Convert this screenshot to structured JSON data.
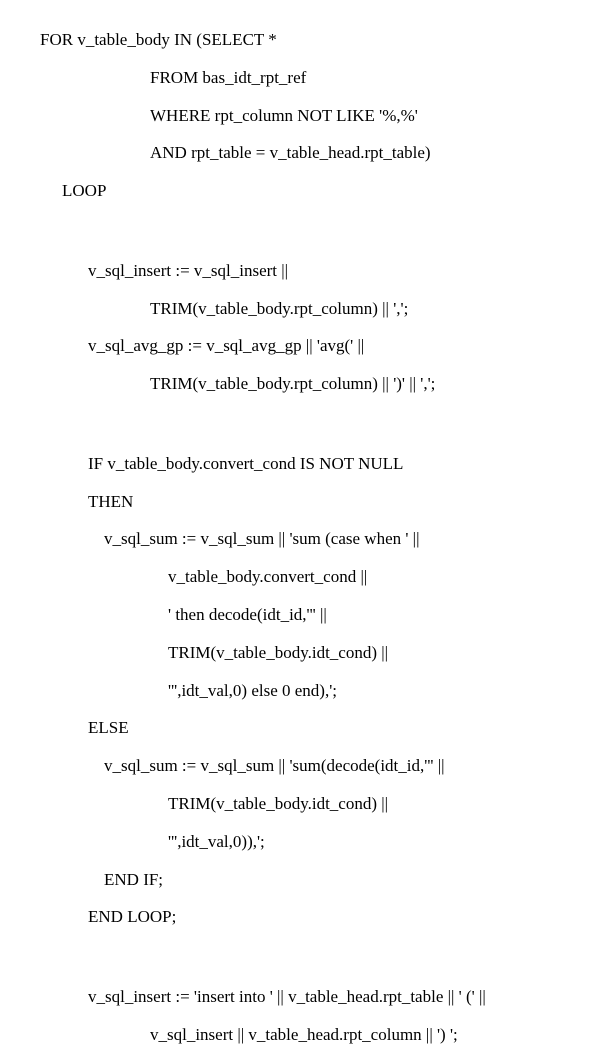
{
  "code": {
    "lines": [
      {
        "indent": 0,
        "text": "FOR v_table_body IN (SELECT *"
      },
      {
        "indent": 110,
        "text": "FROM bas_idt_rpt_ref"
      },
      {
        "indent": 110,
        "text": "WHERE rpt_column NOT LIKE '%,%'"
      },
      {
        "indent": 110,
        "text": "AND rpt_table = v_table_head.rpt_table)"
      },
      {
        "indent": 22,
        "text": "LOOP"
      },
      {
        "indent": 0,
        "text": ""
      },
      {
        "indent": 48,
        "text": "v_sql_insert := v_sql_insert ||"
      },
      {
        "indent": 110,
        "text": "TRIM(v_table_body.rpt_column) || ',';"
      },
      {
        "indent": 48,
        "text": "v_sql_avg_gp := v_sql_avg_gp || 'avg(' ||"
      },
      {
        "indent": 110,
        "text": "TRIM(v_table_body.rpt_column) || ')' || ',';"
      },
      {
        "indent": 0,
        "text": ""
      },
      {
        "indent": 48,
        "text": "IF v_table_body.convert_cond IS NOT NULL"
      },
      {
        "indent": 48,
        "text": "THEN"
      },
      {
        "indent": 64,
        "text": "v_sql_sum := v_sql_sum || 'sum (case when ' ||"
      },
      {
        "indent": 128,
        "text": "v_table_body.convert_cond ||"
      },
      {
        "indent": 128,
        "text": "' then decode(idt_id,''' ||"
      },
      {
        "indent": 128,
        "text": "TRIM(v_table_body.idt_cond) ||"
      },
      {
        "indent": 128,
        "text": "''',idt_val,0) else 0 end),';"
      },
      {
        "indent": 48,
        "text": "ELSE"
      },
      {
        "indent": 64,
        "text": "v_sql_sum := v_sql_sum || 'sum(decode(idt_id,''' ||"
      },
      {
        "indent": 128,
        "text": "TRIM(v_table_body.idt_cond) ||"
      },
      {
        "indent": 128,
        "text": "''',idt_val,0)),';"
      },
      {
        "indent": 64,
        "text": "END IF;"
      },
      {
        "indent": 48,
        "text": "END LOOP;"
      },
      {
        "indent": 0,
        "text": ""
      },
      {
        "indent": 48,
        "text": "v_sql_insert := 'insert into ' || v_table_head.rpt_table || ' (' ||"
      },
      {
        "indent": 110,
        "text": "v_sql_insert || v_table_head.rpt_column || ') ';"
      }
    ]
  }
}
